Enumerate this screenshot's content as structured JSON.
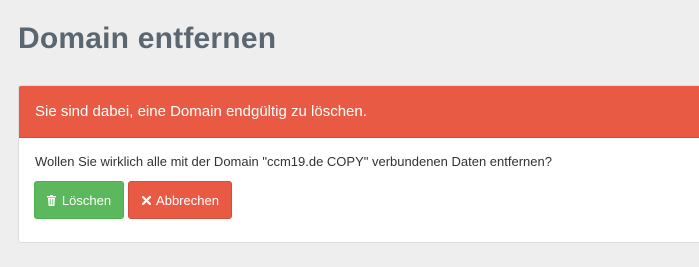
{
  "page": {
    "title": "Domain entfernen"
  },
  "alert": {
    "message": "Sie sind dabei, eine Domain endgültig zu löschen."
  },
  "confirm": {
    "question": "Wollen Sie wirklich alle mit der Domain \"ccm19.de COPY\" verbundenen Daten entfernen?"
  },
  "buttons": {
    "delete_label": "Löschen",
    "delete_icon": "trash-icon",
    "cancel_label": "Abbrechen",
    "cancel_icon": "close-icon"
  },
  "colors": {
    "danger": "#e95a44",
    "success": "#5cb85c",
    "title": "#5a6670",
    "background": "#eeeeee"
  }
}
